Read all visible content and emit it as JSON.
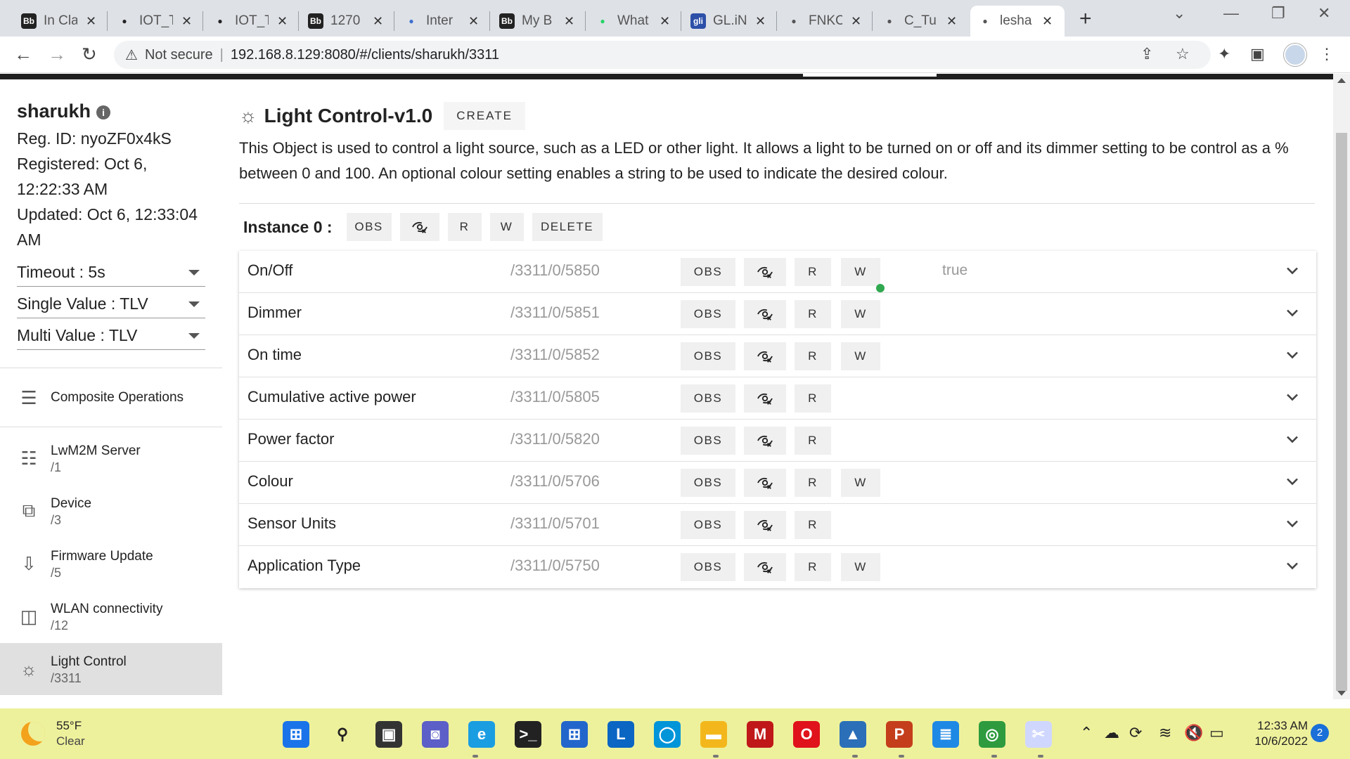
{
  "browser": {
    "tabs": [
      {
        "title": "In Cla",
        "fav": "Bb",
        "color": "#222222"
      },
      {
        "title": "IOT_T",
        "fav": "",
        "color": "#222222",
        "icon": "github-icon"
      },
      {
        "title": "IOT_T",
        "fav": "",
        "color": "#222222",
        "icon": "github-icon"
      },
      {
        "title": "1270",
        "fav": "Bb",
        "color": "#222222"
      },
      {
        "title": "Inter",
        "fav": "",
        "color": "#3b6fd1",
        "icon": "thermometer-icon"
      },
      {
        "title": "My B",
        "fav": "Bb",
        "color": "#222222"
      },
      {
        "title": "What",
        "fav": "",
        "color": "#25d366",
        "icon": "whatsapp-icon"
      },
      {
        "title": "GL.iN",
        "fav": "gli",
        "color": "#2c4fa8"
      },
      {
        "title": "FNKC",
        "fav": "",
        "color": "#555555",
        "icon": "globe-icon"
      },
      {
        "title": "C_Tu",
        "fav": "",
        "color": "#555555",
        "icon": "globe-icon"
      },
      {
        "title": "lesha",
        "fav": "",
        "color": "#555555",
        "icon": "leshan-icon",
        "active": true
      }
    ],
    "security": "Not secure",
    "url": "192.168.8.129:8080/#/clients/sharukh/3311"
  },
  "client": {
    "name": "sharukh",
    "reg_id": "Reg. ID: nyoZF0x4kS",
    "registered": "Registered: Oct 6, 12:22:33 AM",
    "updated": "Updated: Oct 6, 12:33:04 AM",
    "timeout": "Timeout : 5s",
    "single_value": "Single Value : TLV",
    "multi_value": "Multi Value : TLV"
  },
  "sidebar": {
    "composite": "Composite Operations",
    "objects": [
      {
        "label": "LwM2M Server",
        "id": "/1",
        "icon": "server-icon"
      },
      {
        "label": "Device",
        "id": "/3",
        "icon": "device-icon"
      },
      {
        "label": "Firmware Update",
        "id": "/5",
        "icon": "firmware-icon"
      },
      {
        "label": "WLAN connectivity",
        "id": "/12",
        "icon": "wlan-icon"
      },
      {
        "label": "Light Control",
        "id": "/3311",
        "icon": "lightbulb-icon",
        "active": true
      }
    ]
  },
  "object": {
    "title": "Light Control-v1.0",
    "create_label": "CREATE",
    "description": "This Object is used to control a light source, such as a LED or other light.  It allows a light to be turned on or off and its dimmer setting to be control as a % between 0 and 100. An optional colour setting enables a string to be used to indicate the desired colour.",
    "instance": {
      "title": "Instance 0 :",
      "obs": "OBS",
      "r": "R",
      "w": "W",
      "delete": "DELETE"
    },
    "resources": [
      {
        "name": "On/Off",
        "path": "/3311/0/5850",
        "writable": true,
        "value": "true",
        "observed": true
      },
      {
        "name": "Dimmer",
        "path": "/3311/0/5851",
        "writable": true,
        "value": ""
      },
      {
        "name": "On time",
        "path": "/3311/0/5852",
        "writable": true,
        "value": ""
      },
      {
        "name": "Cumulative active power",
        "path": "/3311/0/5805",
        "writable": false,
        "value": ""
      },
      {
        "name": "Power factor",
        "path": "/3311/0/5820",
        "writable": false,
        "value": ""
      },
      {
        "name": "Colour",
        "path": "/3311/0/5706",
        "writable": true,
        "value": ""
      },
      {
        "name": "Sensor Units",
        "path": "/3311/0/5701",
        "writable": false,
        "value": ""
      },
      {
        "name": "Application Type",
        "path": "/3311/0/5750",
        "writable": true,
        "value": ""
      }
    ],
    "btn_obs": "OBS",
    "btn_r": "R",
    "btn_w": "W"
  },
  "taskbar": {
    "weather_temp": "55°F",
    "weather_cond": "Clear",
    "time": "12:33 AM",
    "date": "10/6/2022",
    "notifications": "2"
  },
  "colors": {
    "accent_green": "#2fa84f",
    "taskbar": "#eef19c"
  }
}
